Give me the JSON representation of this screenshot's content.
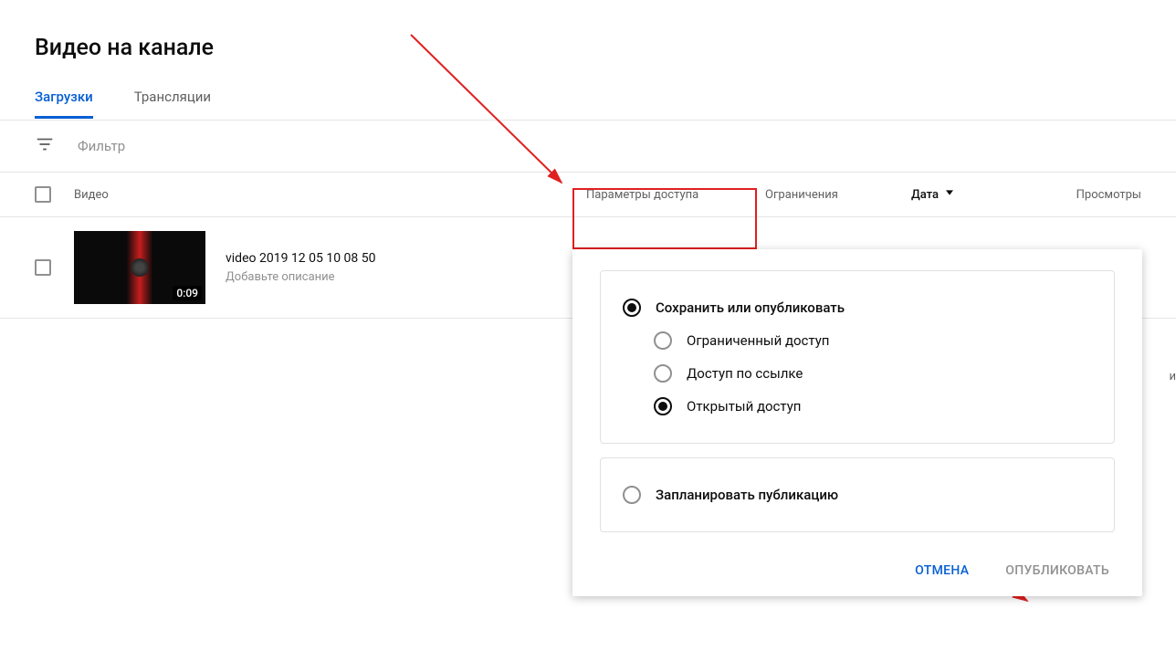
{
  "page_title": "Видео на канале",
  "tabs": [
    {
      "label": "Загрузки",
      "active": true
    },
    {
      "label": "Трансляции",
      "active": false
    }
  ],
  "filter": {
    "placeholder": "Фильтр"
  },
  "columns": {
    "video": "Видео",
    "access": "Параметры доступа",
    "restrictions": "Ограничения",
    "date": "Дата",
    "views": "Просмотры"
  },
  "videos": [
    {
      "title": "video 2019 12 05 10 08 50",
      "description_placeholder": "Добавьте описание",
      "duration": "0:09"
    }
  ],
  "side_char": "и",
  "visibility_panel": {
    "save_or_publish": "Сохранить или опубликовать",
    "options": [
      {
        "label": "Ограниченный доступ",
        "selected": false
      },
      {
        "label": "Доступ по ссылке",
        "selected": false
      },
      {
        "label": "Открытый доступ",
        "selected": true
      }
    ],
    "schedule": "Запланировать публикацию",
    "cancel": "ОТМЕНА",
    "publish": "ОПУБЛИКОВАТЬ"
  },
  "colors": {
    "accent": "#065fd4",
    "annotation": "#e02020"
  }
}
